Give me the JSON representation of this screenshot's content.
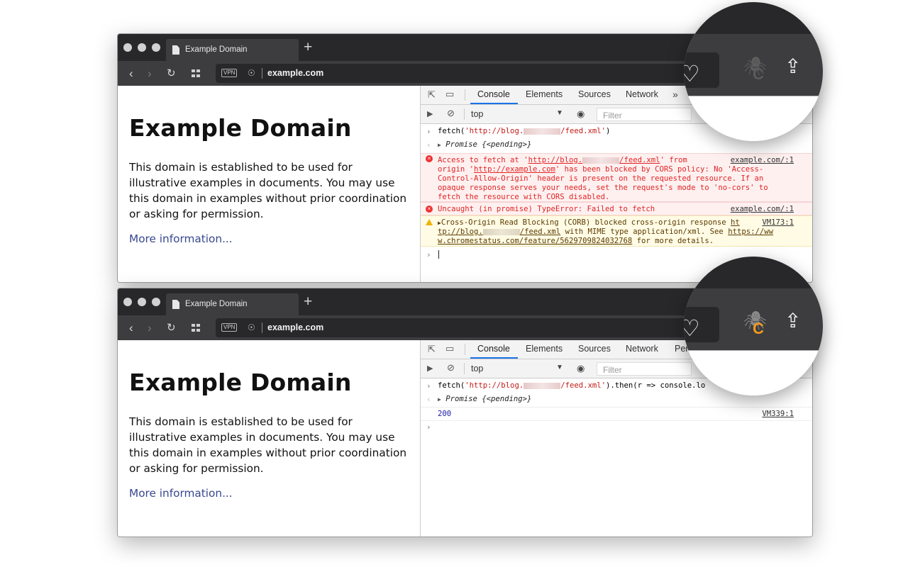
{
  "tab_title": "Example Domain",
  "new_tab_glyph": "+",
  "vpn_label": "VPN",
  "url": "example.com",
  "page": {
    "heading": "Example Domain",
    "paragraph": "This domain is established to be used for illustrative examples in documents. You may use this domain in examples without prior coordination or asking for permission.",
    "link": "More information..."
  },
  "devtools": {
    "tabs_1": [
      "Console",
      "Elements",
      "Sources",
      "Network"
    ],
    "tabs_2": [
      "Console",
      "Elements",
      "Sources",
      "Network",
      "Per"
    ],
    "more_tabs": "»",
    "context": "top",
    "filter_placeholder": "Filter"
  },
  "console_1": {
    "input": [
      "fetch(",
      "'http://blog.",
      "/feed.xml'",
      ")"
    ],
    "promise": "Promise {<pending>}",
    "error1_lines": [
      [
        "Access to fetch at '",
        "http://blog.",
        "/feed.xml",
        "' from"
      ],
      [
        "origin '",
        "http://example.com",
        "' has been blocked by CORS policy: No 'Access-"
      ],
      [
        "Control-Allow-Origin' header is present on the requested resource. If an"
      ],
      [
        "opaque response serves your needs, set the request's mode to 'no-cors' to"
      ],
      [
        "fetch the resource with CORS disabled."
      ]
    ],
    "error1_src": "example.com/:1",
    "error2": "Uncaught (in promise) TypeError: Failed to fetch",
    "error2_src": "example.com/:1",
    "warn_line1": "Cross-Origin Read Blocking (CORB) blocked cross-origin response ",
    "warn_link1a": "ht",
    "warn_src": "VM173:1",
    "warn_link1b": "tp://blog.",
    "warn_link1c": "/feed.xml",
    "warn_line2": " with MIME type application/xml. See ",
    "warn_link2a": "https://ww",
    "warn_link3": "w.chromestatus.com/feature/5629709824032768",
    "warn_line3": " for more details."
  },
  "console_2": {
    "input_a": "fetch(",
    "input_b": "'http://blog.",
    "input_c": "/feed.xml'",
    "input_d": ").then(r => console.lo",
    "promise": "Promise {<pending>}",
    "result": "200",
    "result_src": "VM339:1"
  },
  "icons": {
    "back": "‹",
    "forward": "›",
    "reload": "↻",
    "globe": "🌐",
    "heart": "♡",
    "bug": "🕷",
    "c_badge": "C",
    "share": "⇪",
    "prompt": "›",
    "return": "‹",
    "eye": "◉",
    "block": "⊘",
    "play": "▶",
    "caret": "▼"
  },
  "colors": {
    "titlebar": "#28282b",
    "toolbar": "#3d3d40",
    "link": "#38488f",
    "error": "#e02525",
    "warn_bg": "#fffbe5",
    "badge_active": "#f29a1d"
  }
}
